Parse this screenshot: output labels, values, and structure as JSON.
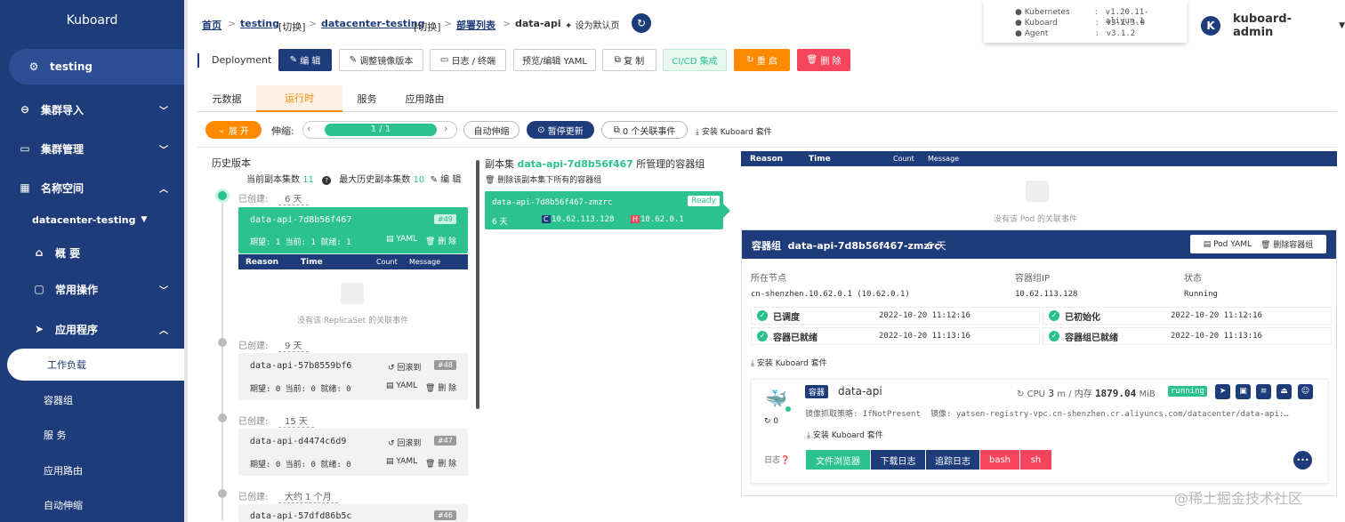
{
  "sidebar": {
    "brand": "Kuboard",
    "items": [
      {
        "label": "testing",
        "icon": "gear-icon"
      },
      {
        "label": "集群导入",
        "icon": "link-icon"
      },
      {
        "label": "集群管理",
        "icon": "box-icon"
      },
      {
        "label": "名称空间",
        "icon": "grid-icon"
      }
    ],
    "namespace": "datacenter-testing",
    "sub": {
      "overview": "概 要",
      "common_ops": "常用操作",
      "apps": "应用程序"
    },
    "leaf": [
      "工作负载",
      "容器组",
      "服 务",
      "应用路由",
      "自动伸缩"
    ]
  },
  "breadcrumb": {
    "home": "首页",
    "cluster": "testing",
    "switch1": "[切换]",
    "namespace": "datacenter-testing",
    "switch2": "[切换]",
    "list": "部署列表",
    "current": "data-api",
    "default_label": "设为默认页",
    "sep": ">"
  },
  "versions": [
    {
      "name": "Kubernetes",
      "value": "v1.20.11-aliyun.1"
    },
    {
      "name": "Kuboard",
      "value": "v3.1.3.0"
    },
    {
      "name": "Agent",
      "value": "v3.1.2"
    }
  ],
  "version_colon": ":",
  "user": {
    "initial": "K",
    "name": "kuboard-admin"
  },
  "toolbar": {
    "kind": "Deployment",
    "edit": "编 辑",
    "adjust_image": "调整镜像版本",
    "logs": "日志 / 终端",
    "yaml": "预览/编辑 YAML",
    "copy": "复 制",
    "cicd": "CI/CD 集成",
    "restart": "重 启",
    "delete": "删 除"
  },
  "tabs": [
    "元数据",
    "运行时",
    "服务",
    "应用路由"
  ],
  "runtime": {
    "expand": "展 开",
    "scale_label": "伸缩:",
    "scale_value": "1 / 1",
    "autoscale": "自动伸缩",
    "pause": "暂停更新",
    "events": "0 个关联事件",
    "install_suite": "安装 Kuboard 套件"
  },
  "history": {
    "title": "历史版本",
    "current_label": "当前副本集数",
    "current_count": "11",
    "max_label": "最大历史副本集数",
    "max_count": "10",
    "edit": "编 辑",
    "created_label": "已创建:",
    "active": {
      "age": "6 天",
      "name": "data-api-7d8b56f467",
      "rev": "#49",
      "status": "期望: 1 当前: 1 就绪: 1",
      "yaml": "YAML",
      "del": "删 除"
    },
    "empty_events": "没有该 ReplicaSet 的关联事件",
    "rollback": "回滚到",
    "others": [
      {
        "age": "9 天",
        "name": "data-api-57b8559bf6",
        "rev": "#48",
        "status": "期望: 0 当前: 0 就绪: 0"
      },
      {
        "age": "15 天",
        "name": "data-api-d4474c6d9",
        "rev": "#47",
        "status": "期望: 0 当前: 0 就绪: 0"
      },
      {
        "age": "大约 1 个月",
        "name": "data-api-57dfd86b5c",
        "rev": "#46",
        "status": ""
      }
    ]
  },
  "event_headers": {
    "reason": "Reason",
    "time": "Time",
    "count": "Count",
    "message": "Message"
  },
  "replicaset": {
    "prefix": "副本集",
    "name": "data-api-7d8b56f467",
    "suffix": "所管理的容器组",
    "delete_all": "删除该副本集下所有的容器组",
    "pod_name": "data-api-7d8b56f467-zmzrc",
    "ready": "Ready",
    "age": "6 天",
    "c_tag": "C",
    "c_ip": "10.62.113.128",
    "h_tag": "H",
    "h_ip": "10.62.0.1"
  },
  "pod_events_empty": "没有该 Pod 的关联事件",
  "pod": {
    "title_prefix": "容器组",
    "name": "data-api-7d8b56f467-zmzrc",
    "age": "6 天",
    "yaml_btn": "Pod YAML",
    "delete_btn": "删除容器组",
    "node_label": "所在节点",
    "node_value": "cn-shenzhen.10.62.0.1 (10.62.0.1)",
    "ip_label": "容器组IP",
    "ip_value": "10.62.113.128",
    "state_label": "状态",
    "state_value": "Running",
    "conditions": [
      {
        "label": "已调度",
        "time": "2022-10-20 11:12:16"
      },
      {
        "label": "已初始化",
        "time": "2022-10-20 11:12:16"
      },
      {
        "label": "容器已就绪",
        "time": "2022-10-20 11:13:16"
      },
      {
        "label": "容器组已就绪",
        "time": "2022-10-20 11:13:16"
      }
    ],
    "install_suite": "安装 Kuboard 套件"
  },
  "container": {
    "tag": "容器",
    "name": "data-api",
    "cpu_label": "CPU",
    "cpu_value": "3",
    "cpu_unit": "m / 内存",
    "mem_value": "1879.04",
    "mem_unit": "MiB",
    "state": "running",
    "restarts": "0",
    "pull_policy": "镜像抓取策略: IfNotPresent",
    "image": "镜像: yatsen-registry-vpc.cn-shenzhen.cr.aliyuncs.com/datacenter/data-api:…",
    "install_suite": "安装 Kuboard 套件",
    "log_label": "日志",
    "log_buttons": [
      "文件浏览器",
      "下载日志",
      "追踪日志",
      "bash",
      "sh"
    ],
    "more": "•••"
  },
  "watermark": "@稀土掘金技术社区",
  "colors": {
    "navy": "#1f3c7a",
    "green": "#2bc28f",
    "orange": "#ff8a00",
    "red": "#f5455c"
  }
}
